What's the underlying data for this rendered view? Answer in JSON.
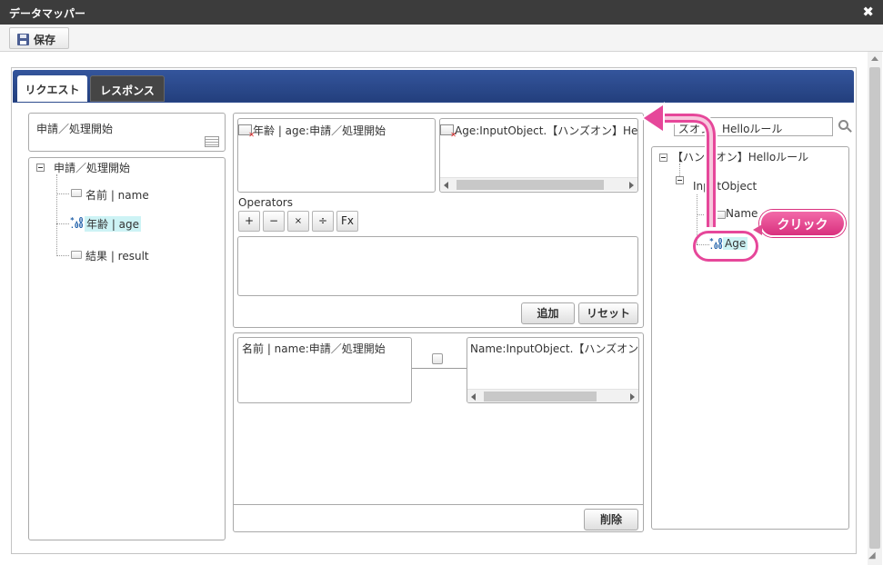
{
  "window": {
    "title": "データマッパー"
  },
  "toolbar": {
    "save_label": "保存"
  },
  "tabs": [
    {
      "label": "リクエスト",
      "active": true
    },
    {
      "label": "レスポンス",
      "active": false
    }
  ],
  "left": {
    "header": "申請／処理開始",
    "tree_root": "申請／処理開始",
    "items": [
      {
        "label": "名前 | name",
        "type": "string"
      },
      {
        "label": "年齢 | age",
        "type": "number",
        "selected": true
      },
      {
        "label": "結果 | result",
        "type": "string"
      }
    ]
  },
  "middle": {
    "source_field": "年齢 | age:申請／処理開始",
    "target_field": "Age:InputObject.【ハンズオン】Helloル",
    "operators_label": "Operators",
    "operators": [
      "+",
      "−",
      "×",
      "÷",
      "Fx"
    ],
    "add_button": "追加",
    "reset_button": "リセット",
    "mapping": {
      "source": "名前 | name:申請／処理開始",
      "target": "Name:InputObject.【ハンズオン】Hel"
    },
    "delete_button": "削除"
  },
  "right": {
    "search_value": "ズオン】Helloルール",
    "tree_root": "【ハンズオン】Helloルール",
    "tree_child": "InputObject",
    "items": [
      {
        "label": "Name",
        "type": "string"
      },
      {
        "label": "Age",
        "type": "number",
        "selected": true
      }
    ]
  },
  "annotation": {
    "label": "クリック",
    "color": "#e04b90"
  }
}
